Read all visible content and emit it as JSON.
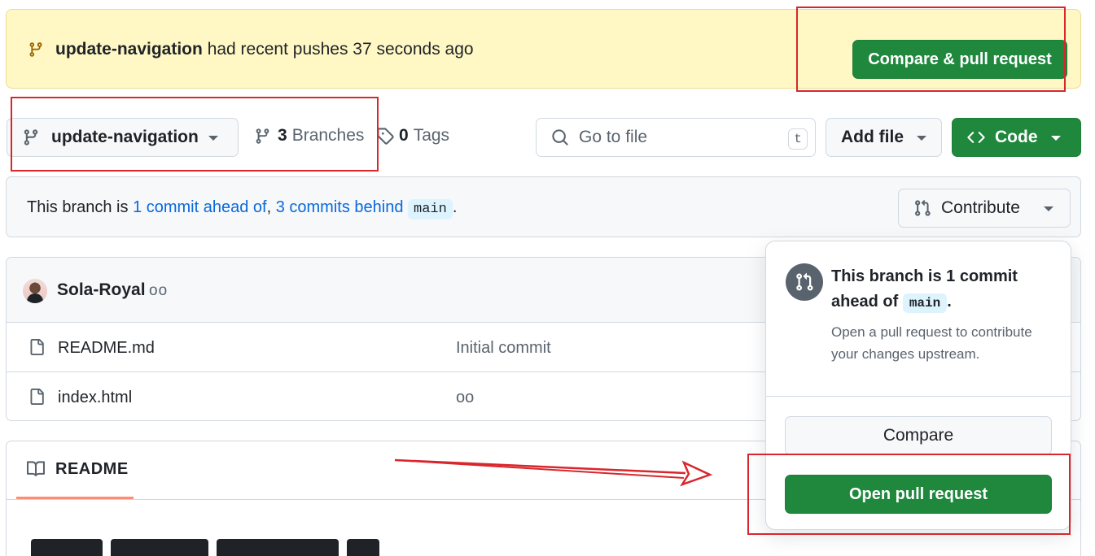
{
  "banner": {
    "branch": "update-navigation",
    "message": "had recent pushes 37 seconds ago",
    "button_label": "Compare & pull request"
  },
  "toolbar": {
    "branch_name": "update-navigation",
    "branches_count": "3",
    "branches_label": "Branches",
    "tags_count": "0",
    "tags_label": "Tags",
    "search_placeholder": "Go to file",
    "search_shortcut": "t",
    "add_file_label": "Add file",
    "code_label": "Code"
  },
  "branch_status": {
    "prefix": "This branch is",
    "ahead_link": "1 commit ahead of",
    "separator": ",",
    "behind_link": "3 commits behind",
    "base_branch": "main",
    "suffix": ".",
    "contribute_label": "Contribute"
  },
  "latest_commit": {
    "author": "Sola-Royal",
    "message": "oo"
  },
  "files": [
    {
      "name": "README.md",
      "commit_message": "Initial commit"
    },
    {
      "name": "index.html",
      "commit_message": "oo"
    }
  ],
  "readme": {
    "tab_label": "README"
  },
  "contribute_popover": {
    "title_prefix": "This branch is 1 commit ahead of",
    "base_branch": "main",
    "title_suffix": ".",
    "description": "Open a pull request to contribute your changes upstream.",
    "compare_label": "Compare",
    "open_pr_label": "Open pull request"
  },
  "colors": {
    "primary_green": "#1f883d",
    "link_blue": "#0969da",
    "banner_yellow": "#fff8c5",
    "annotation_red": "#d9262c",
    "tab_underline": "#fd8c73"
  },
  "icons": [
    "git-branch-icon",
    "tag-icon",
    "search-icon",
    "code-icon",
    "git-pull-request-icon",
    "file-icon",
    "book-icon",
    "triangle-down-icon"
  ]
}
